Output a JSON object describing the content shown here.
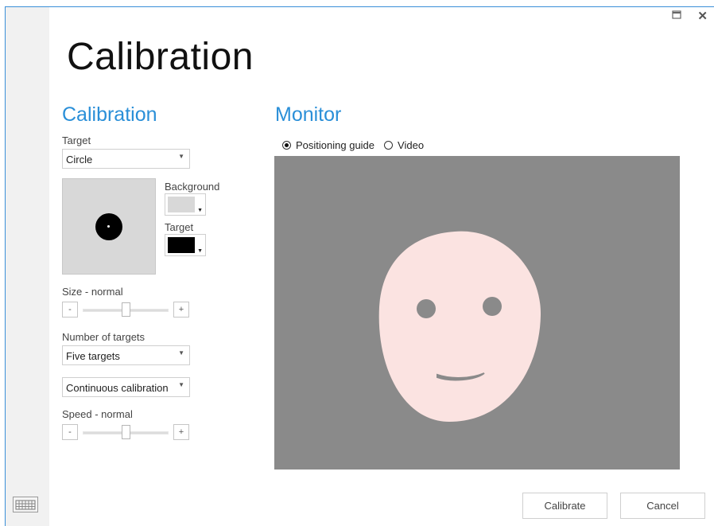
{
  "window": {
    "maximize_symbol": "🗖",
    "close_symbol": "✕"
  },
  "page_title": "Calibration",
  "calibration": {
    "heading": "Calibration",
    "target_label": "Target",
    "target_value": "Circle",
    "background_label": "Background",
    "background_color": "#d8d8d8",
    "target_color_label": "Target",
    "target_color": "#000000",
    "size_label": "Size - normal",
    "size_level": 0.5,
    "number_of_targets_label": "Number of targets",
    "number_of_targets_value": "Five targets",
    "mode_value": "Continuous calibration",
    "speed_label": "Speed - normal",
    "speed_level": 0.5,
    "minus": "-",
    "plus": "+"
  },
  "monitor": {
    "heading": "Monitor",
    "options": [
      "Positioning guide",
      "Video"
    ],
    "selected": "Positioning guide",
    "background_color": "#8a8a8a",
    "face_color": "#fbe3e1"
  },
  "buttons": {
    "calibrate": "Calibrate",
    "cancel": "Cancel"
  },
  "icons": {
    "keyboard": "keyboard-icon",
    "dropdown": "chevron-down-icon"
  }
}
